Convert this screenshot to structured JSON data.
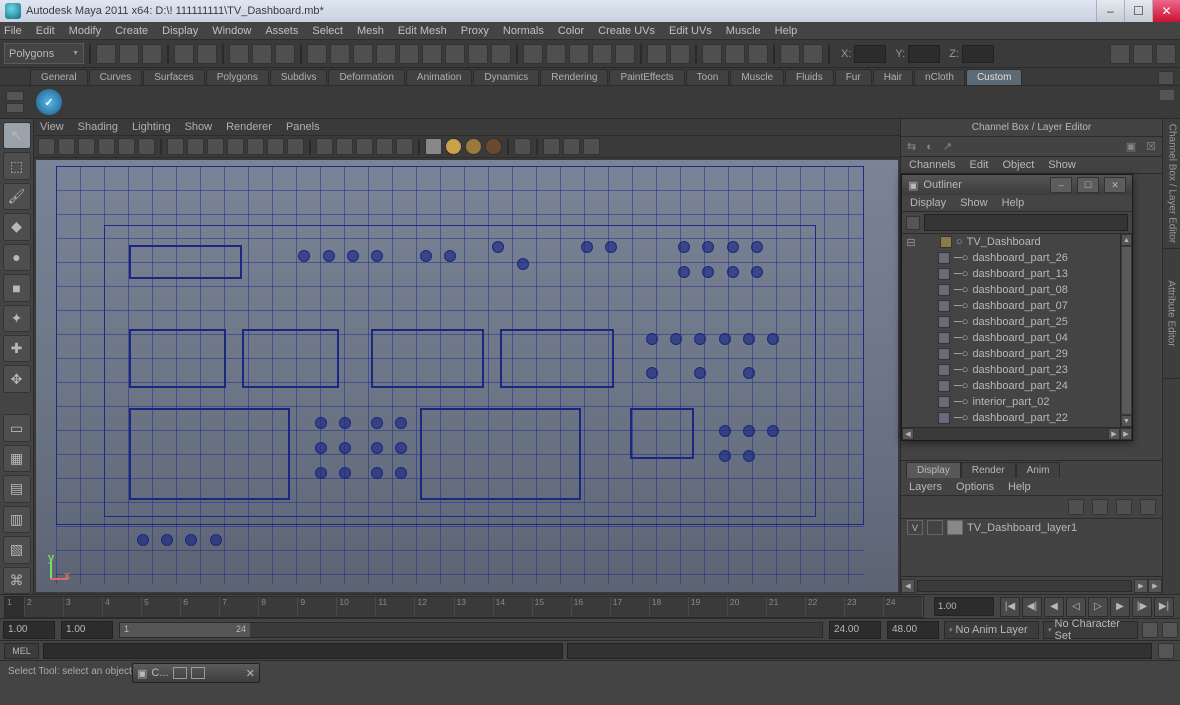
{
  "window_title": "Autodesk Maya 2011 x64: D:\\! 111111111\\TV_Dashboard.mb*",
  "main_menu": [
    "File",
    "Edit",
    "Modify",
    "Create",
    "Display",
    "Window",
    "Assets",
    "Select",
    "Mesh",
    "Edit Mesh",
    "Proxy",
    "Normals",
    "Color",
    "Create UVs",
    "Edit UVs",
    "Muscle",
    "Help"
  ],
  "mode_dropdown": "Polygons",
  "xyz": {
    "x_label": "X:",
    "y_label": "Y:",
    "z_label": "Z:",
    "x": "",
    "y": "",
    "z": ""
  },
  "shelf_tabs": [
    "General",
    "Curves",
    "Surfaces",
    "Polygons",
    "Subdivs",
    "Deformation",
    "Animation",
    "Dynamics",
    "Rendering",
    "PaintEffects",
    "Toon",
    "Muscle",
    "Fluids",
    "Fur",
    "Hair",
    "nCloth",
    "Custom"
  ],
  "shelf_active": "Custom",
  "view_menu": [
    "View",
    "Shading",
    "Lighting",
    "Show",
    "Renderer",
    "Panels"
  ],
  "axis_labels": {
    "x": "x",
    "y": "y"
  },
  "channel_box": {
    "title": "Channel Box / Layer Editor",
    "menus": [
      "Channels",
      "Edit",
      "Object",
      "Show"
    ]
  },
  "outliner": {
    "title": "Outliner",
    "menus": [
      "Display",
      "Show",
      "Help"
    ],
    "search": "",
    "root": "TV_Dashboard",
    "root_icon": "camera",
    "items": [
      "dashboard_part_26",
      "dashboard_part_13",
      "dashboard_part_08",
      "dashboard_part_07",
      "dashboard_part_25",
      "dashboard_part_04",
      "dashboard_part_29",
      "dashboard_part_23",
      "dashboard_part_24",
      "interior_part_02",
      "dashboard_part_22"
    ]
  },
  "layer_editor": {
    "tabs": [
      "Display",
      "Render",
      "Anim"
    ],
    "active": "Display",
    "menus": [
      "Layers",
      "Options",
      "Help"
    ],
    "layer_v": "V",
    "layer_name": "TV_Dashboard_layer1"
  },
  "vtabs": [
    "Channel Box / Layer Editor",
    "Attribute Editor"
  ],
  "timeline": {
    "current": "1",
    "frames": [
      "1",
      "2",
      "3",
      "4",
      "5",
      "6",
      "7",
      "8",
      "9",
      "10",
      "11",
      "12",
      "13",
      "14",
      "15",
      "16",
      "17",
      "18",
      "19",
      "20",
      "21",
      "22",
      "23",
      "24"
    ],
    "playback_end_field": "1.00"
  },
  "range": {
    "anim_start": "1.00",
    "play_start": "1.00",
    "play_start_2": "1",
    "play_end": "24",
    "anim_end": "24.00",
    "total": "48.00",
    "anim_layer": "No Anim Layer",
    "char_set": "No Character Set"
  },
  "command": {
    "type": "MEL",
    "input": "",
    "result": ""
  },
  "help_line": "Select Tool: select an object",
  "taskbar_button": "C..."
}
